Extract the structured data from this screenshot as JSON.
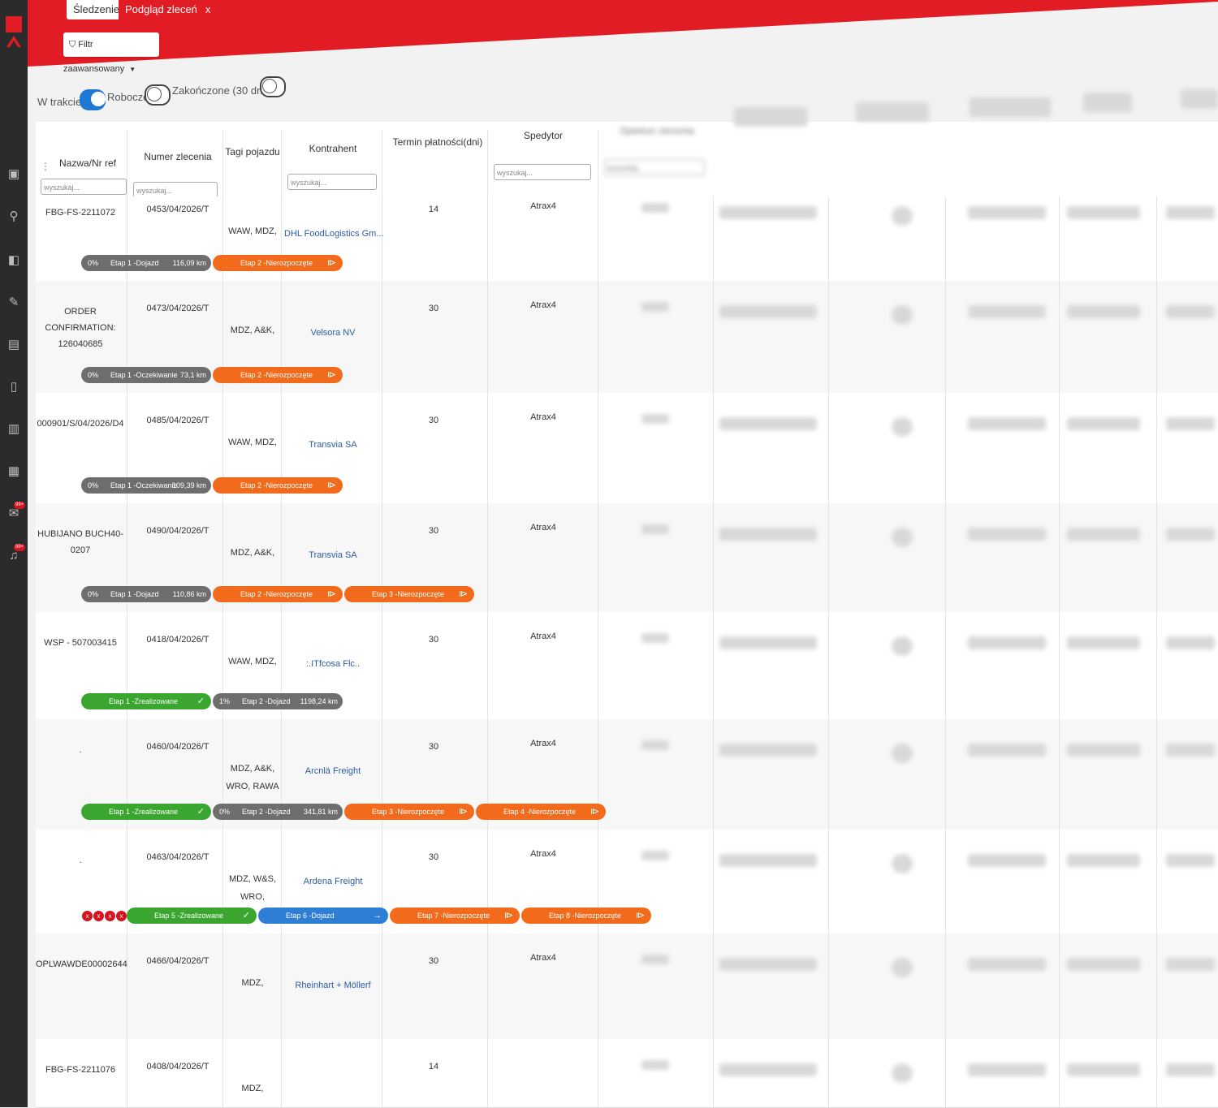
{
  "tabs": {
    "tracking": "Śledzenie",
    "orders": "Podgląd zleceń",
    "close": "x"
  },
  "filter": {
    "label": "Filtr zaawansowany",
    "caret": "▼",
    "icon": "filter-icon"
  },
  "toggles": {
    "in_progress": "W trakcie",
    "draft": "Robocze",
    "finished": "Zakończone (30 dni)",
    "draft_on": true,
    "finished_on": false
  },
  "columns": {
    "name": "Nazwa/Nr ref",
    "order": "Numer zlecenia",
    "tags": "Tagi pojazdu",
    "contractor": "Kontrahent",
    "term": "Termin płatności(dni)",
    "forwarder": "Spedytor",
    "caretaker": "Opiekun zlecenia",
    "search_placeholder": "wyszukaj..."
  },
  "rows": [
    {
      "name": "FBG-FS-2211072",
      "order": "0453/04/2026/T",
      "tags": "WAW, MDZ,",
      "contractor": "DHL FoodLogistics Gm...",
      "term": "14",
      "forwarder": "Atrax4",
      "stages": [
        {
          "pct": "0%",
          "label": "Etap 1 -Dojazd",
          "km": "116,09 km"
        },
        {
          "label": "Etap 2 -Nierozpoczęte",
          "icon": "⧐"
        }
      ]
    },
    {
      "name": "ORDER CONFIRMATION: 126040685",
      "order": "0473/04/2026/T",
      "tags": "MDZ, A&K,",
      "contractor": "Velsora NV",
      "term": "30",
      "forwarder": "Atrax4",
      "stages": [
        {
          "pct": "0%",
          "label": "Etap 1 -Oczekiwanie",
          "km": "73,1 km"
        },
        {
          "label": "Etap 2 -Nierozpoczęte",
          "icon": "⧐"
        }
      ]
    },
    {
      "name": "000901/S/04/2026/D4",
      "order": "0485/04/2026/T",
      "tags": "WAW, MDZ,",
      "contractor": "Transvia SA",
      "term": "30",
      "forwarder": "Atrax4",
      "stages": [
        {
          "pct": "0%",
          "label": "Etap 1 -Oczekiwanie",
          "km": "109,39 km"
        },
        {
          "label": "Etap 2 -Nierozpoczęte",
          "icon": "⧐"
        }
      ]
    },
    {
      "name": "HUBIJANO BUCH40-0207",
      "order": "0490/04/2026/T",
      "tags": "MDZ, A&K,",
      "contractor": "Transvia SA",
      "term": "30",
      "forwarder": "Atrax4",
      "stages": [
        {
          "pct": "0%",
          "label": "Etap 1 -Dojazd",
          "km": "110,86 km"
        },
        {
          "label": "Etap 2 -Nierozpoczęte",
          "icon": "⧐"
        },
        {
          "label": "Etap 3 -Nierozpoczęte",
          "icon": "⧐"
        }
      ]
    },
    {
      "name": "WSP - 507003415",
      "order": "0418/04/2026/T",
      "tags": "WAW, MDZ,",
      "contractor": ":.ITfcosa Flc..",
      "term": "30",
      "forwarder": "Atrax4",
      "stages": [
        {
          "label": "Etap 1 -Zrealizowane",
          "icon": "✓"
        },
        {
          "pct": "1%",
          "label": "Etap 2 -Dojazd",
          "km": "1198,24 km"
        }
      ]
    },
    {
      "name": ".",
      "order": "0460/04/2026/T",
      "tags": "MDZ, A&K, WRO, RAWA",
      "contractor": "Arcnlä Freight",
      "term": "30",
      "forwarder": "Atrax4",
      "stages": [
        {
          "label": "Etap 1 -Zrealizowane",
          "icon": "✓"
        },
        {
          "pct": "0%",
          "label": "Etap 2 -Dojazd",
          "km": "341,81 km"
        },
        {
          "label": "Etap 3 -Nierozpoczęte",
          "icon": "⧐"
        },
        {
          "label": "Etap 4 -Nierozpoczęte",
          "icon": "⧐"
        }
      ]
    },
    {
      "name": ".",
      "order": "0463/04/2026/T",
      "tags": "MDZ, W&S, WRO,",
      "contractor": "Ardena Freight",
      "term": "30",
      "forwarder": "Atrax4",
      "stages": [
        {
          "label": "Etap 5 -Zrealizowane",
          "icon": "✓"
        },
        {
          "label": "Etap 6 -Dojazd",
          "icon": "→"
        },
        {
          "label": "Etap 7 -Nierozpoczęte",
          "icon": "⧐"
        },
        {
          "label": "Etap 8 -Nierozpoczęte",
          "icon": "⧐"
        }
      ],
      "x_marks": [
        "x",
        "x",
        "x",
        "x"
      ]
    },
    {
      "name": "OPLWAWDE00002644",
      "order": "0466/04/2026/T",
      "tags": "MDZ,",
      "contractor": "Rheinhart + Möllerf",
      "term": "30",
      "forwarder": "Atrax4",
      "stages": []
    },
    {
      "name": "FBG-FS-2211076",
      "order": "0408/04/2026/T",
      "tags": "MDZ,",
      "contractor": "",
      "term": "14",
      "forwarder": "",
      "stages": []
    }
  ],
  "colors": {
    "brand_red": "#e11c24",
    "orange": "#f26b1d",
    "green": "#3aa52f",
    "blue": "#2f7ed6",
    "grey": "#6e6e6e"
  }
}
